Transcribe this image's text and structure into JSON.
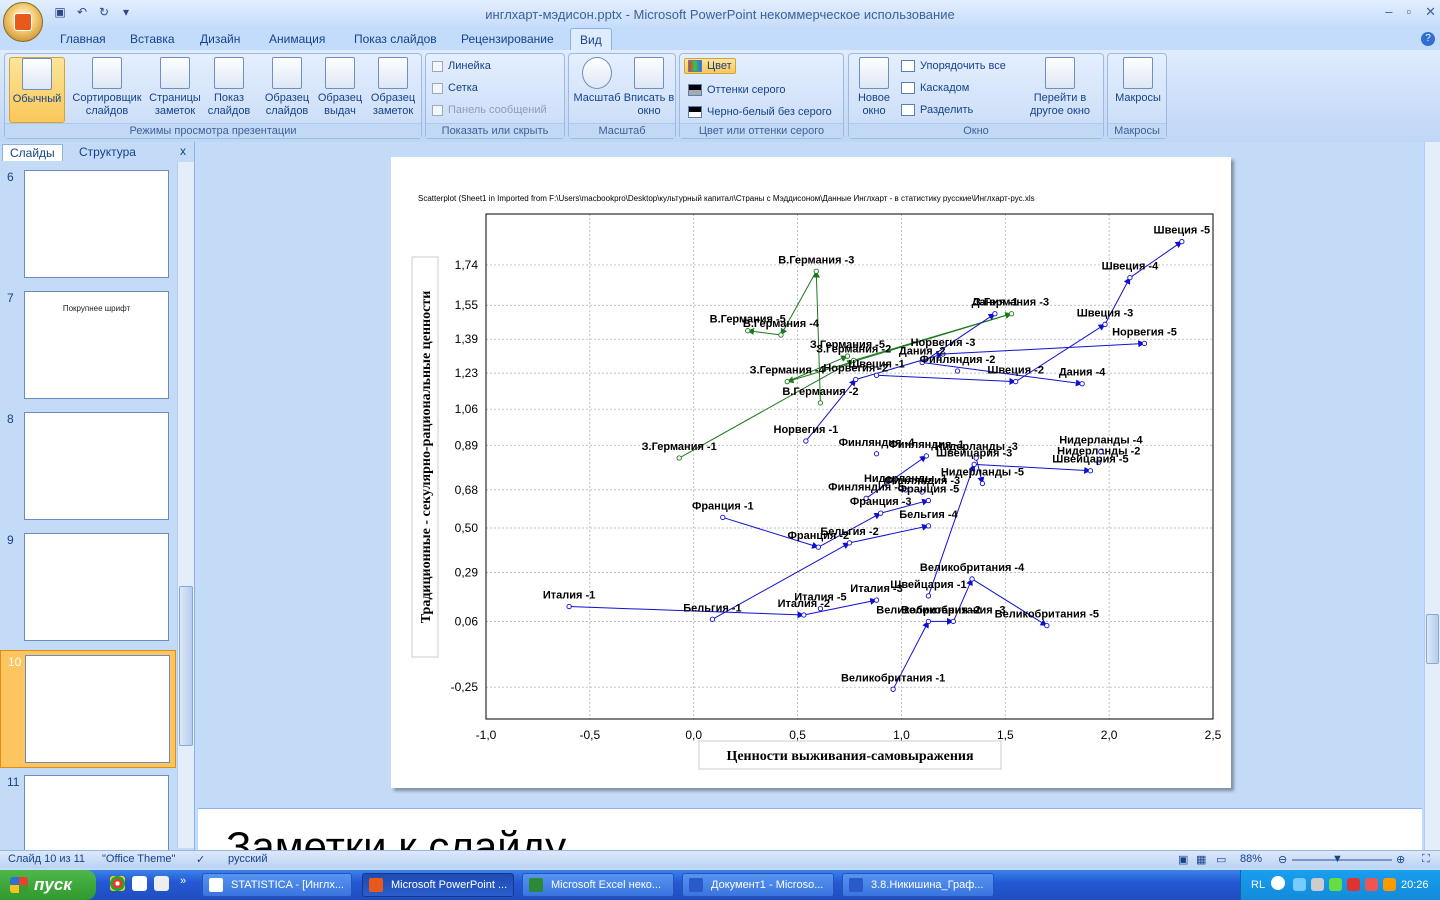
{
  "window": {
    "title": "инглхарт-мэдисон.pptx - Microsoft PowerPoint некоммерческое использование"
  },
  "ribbon": {
    "tabs": [
      "Главная",
      "Вставка",
      "Дизайн",
      "Анимация",
      "Показ слайдов",
      "Рецензирование",
      "Вид"
    ],
    "active_tab": "Вид",
    "groups": {
      "views": {
        "name": "Режимы просмотра презентации",
        "buttons": [
          "Обычный",
          "Сортировщик слайдов",
          "Страницы заметок",
          "Показ слайдов",
          "Образец слайдов",
          "Образец выдач",
          "Образец заметок"
        ]
      },
      "show": {
        "name": "Показать или скрыть",
        "items": [
          "Линейка",
          "Сетка",
          "Панель сообщений"
        ]
      },
      "zoom": {
        "name": "Масштаб",
        "buttons": [
          "Масштаб",
          "Вписать в окно"
        ]
      },
      "color": {
        "name": "Цвет или оттенки серого",
        "items": [
          "Цвет",
          "Оттенки серого",
          "Черно-белый без серого"
        ]
      },
      "window": {
        "name": "Окно",
        "new_window": "Новое окно",
        "items": [
          "Упорядочить все",
          "Каскадом",
          "Разделить"
        ],
        "switch": "Перейти в другое окно"
      },
      "macros": {
        "name": "Макросы",
        "button": "Макросы"
      }
    }
  },
  "panel": {
    "tabs": [
      "Слайды",
      "Структура"
    ],
    "close": "x"
  },
  "thumbnails": [
    {
      "num": "6",
      "caption": ""
    },
    {
      "num": "7",
      "caption": "Покрупнее шрифт"
    },
    {
      "num": "8",
      "caption": ""
    },
    {
      "num": "9",
      "caption": ""
    },
    {
      "num": "10",
      "caption": ""
    },
    {
      "num": "11",
      "caption": ""
    }
  ],
  "notes": {
    "text": "Заметки к слайду"
  },
  "status": {
    "slide": "Слайд 10 из 11",
    "theme": "\"Office Theme\"",
    "lang": "русский",
    "zoom": "88%"
  },
  "taskbar": {
    "start": "пуск",
    "items": [
      "STATISTICA - [Инглх...",
      "Microsoft PowerPoint ...",
      "Microsoft Excel неко...",
      "Документ1 - Microso...",
      "3.8.Никишина_Граф..."
    ],
    "lang": "RL",
    "time": "20:26"
  },
  "chart_data": {
    "type": "scatter",
    "title": "Scatterplot (Sheet1 in Imported from F:\\Users\\macbookpro\\Desktop\\культурный капитал\\Страны с Мэддисоном\\Данные Инглхарт - в статистику русские\\Инглхарт-рус.xls",
    "xlabel": "Ценности выживания-самовыражения",
    "ylabel": "Традиционные - секулярно-рациональные ценности",
    "xlim": [
      -1.0,
      2.5
    ],
    "ylim": [
      -0.4,
      1.98
    ],
    "xticks": [
      "-1,0",
      "-0,5",
      "0,0",
      "0,5",
      "1,0",
      "1,5",
      "2,0",
      "2,5"
    ],
    "yticks": [
      "-0,25",
      "0,06",
      "0,29",
      "0,50",
      "0,68",
      "0,89",
      "1,06",
      "1,23",
      "1,39",
      "1,55",
      "1,74"
    ],
    "xtick_values": [
      -1.0,
      -0.5,
      0.0,
      0.5,
      1.0,
      1.5,
      2.0,
      2.5
    ],
    "ytick_values": [
      -0.25,
      0.06,
      0.29,
      0.5,
      0.68,
      0.89,
      1.06,
      1.23,
      1.39,
      1.55,
      1.74
    ],
    "grid": true,
    "series": [
      {
        "name": "З.Германия",
        "color": "#1a7a1a",
        "points": [
          {
            "label": "З.Германия -1",
            "x": -0.07,
            "y": 0.83
          },
          {
            "label": "З.Германия -2",
            "x": 0.77,
            "y": 1.29
          },
          {
            "label": "З.Германия -3",
            "x": 1.53,
            "y": 1.51
          },
          {
            "label": "З.Германия -4",
            "x": 0.45,
            "y": 1.19
          },
          {
            "label": "З.Германия -5",
            "x": 0.74,
            "y": 1.31
          }
        ]
      },
      {
        "name": "В.Германия",
        "color": "#1a7a1a",
        "points": [
          {
            "label": "В.Германия -2",
            "x": 0.61,
            "y": 1.09
          },
          {
            "label": "В.Германия -3",
            "x": 0.59,
            "y": 1.71
          },
          {
            "label": "В.Германия -4",
            "x": 0.42,
            "y": 1.41
          },
          {
            "label": "В.Германия -5",
            "x": 0.26,
            "y": 1.43
          }
        ]
      },
      {
        "name": "Швеция",
        "color": "#1010d0",
        "points": [
          {
            "label": "Швеция -1",
            "x": 0.88,
            "y": 1.22
          },
          {
            "label": "Швеция -2",
            "x": 1.55,
            "y": 1.19
          },
          {
            "label": "Швеция -3",
            "x": 1.98,
            "y": 1.46
          },
          {
            "label": "Швеция -4",
            "x": 2.1,
            "y": 1.68
          },
          {
            "label": "Швеция -5",
            "x": 2.35,
            "y": 1.85
          }
        ]
      },
      {
        "name": "Норвегия",
        "color": "#1010d0",
        "points": [
          {
            "label": "Норвегия -1",
            "x": 0.54,
            "y": 0.91
          },
          {
            "label": "Норвегия -2",
            "x": 0.78,
            "y": 1.2
          },
          {
            "label": "Норвегия -3",
            "x": 1.2,
            "y": 1.32
          },
          {
            "label": "Норвегия -5",
            "x": 2.17,
            "y": 1.37
          }
        ]
      },
      {
        "name": "Дания",
        "color": "#1010d0",
        "points": [
          {
            "label": "Дания -1",
            "x": 1.45,
            "y": 1.51
          },
          {
            "label": "Дания -2",
            "x": 1.1,
            "y": 1.28
          },
          {
            "label": "Дания -4",
            "x": 1.87,
            "y": 1.18
          }
        ]
      },
      {
        "name": "Финляндия",
        "color": "#1010d0",
        "points": [
          {
            "label": "Финляндия -1",
            "x": 1.12,
            "y": 0.84
          },
          {
            "label": "Финляндия -2",
            "x": 1.27,
            "y": 1.24
          },
          {
            "label": "Финляндия -3",
            "x": 1.1,
            "y": 0.67
          },
          {
            "label": "Финляндия -4",
            "x": 0.88,
            "y": 0.85
          },
          {
            "label": "Финляндия -5",
            "x": 0.83,
            "y": 0.64
          }
        ]
      },
      {
        "name": "Нидерланды",
        "color": "#1010d0",
        "points": [
          {
            "label": "Нидерланды -1",
            "x": 1.02,
            "y": 0.68
          },
          {
            "label": "Нидерланды -2",
            "x": 1.95,
            "y": 0.81
          },
          {
            "label": "Нидерланды -3",
            "x": 1.36,
            "y": 0.83
          },
          {
            "label": "Нидерланды -4",
            "x": 1.96,
            "y": 0.86
          },
          {
            "label": "Нидерланды -5",
            "x": 1.39,
            "y": 0.71
          }
        ]
      },
      {
        "name": "Швейцария",
        "color": "#1010d0",
        "points": [
          {
            "label": "Швейцария -1",
            "x": 1.13,
            "y": 0.18
          },
          {
            "label": "Швейцария -3",
            "x": 1.35,
            "y": 0.8
          },
          {
            "label": "Швейцария -5",
            "x": 1.91,
            "y": 0.77
          }
        ]
      },
      {
        "name": "Франция",
        "color": "#1010d0",
        "points": [
          {
            "label": "Франция -1",
            "x": 0.14,
            "y": 0.55
          },
          {
            "label": "Франция -2",
            "x": 0.6,
            "y": 0.41
          },
          {
            "label": "Франция -3",
            "x": 0.9,
            "y": 0.57
          },
          {
            "label": "Франция -5",
            "x": 1.13,
            "y": 0.63
          }
        ]
      },
      {
        "name": "Бельгия",
        "color": "#1010d0",
        "points": [
          {
            "label": "Бельгия -1",
            "x": 0.09,
            "y": 0.07
          },
          {
            "label": "Бельгия -2",
            "x": 0.75,
            "y": 0.43
          },
          {
            "label": "Бельгия -4",
            "x": 1.13,
            "y": 0.51
          }
        ]
      },
      {
        "name": "Италия",
        "color": "#1010d0",
        "points": [
          {
            "label": "Италия -1",
            "x": -0.6,
            "y": 0.13
          },
          {
            "label": "Италия -2",
            "x": 0.53,
            "y": 0.09
          },
          {
            "label": "Италия -3",
            "x": 0.88,
            "y": 0.16
          },
          {
            "label": "Италия -5",
            "x": 0.61,
            "y": 0.12
          }
        ]
      },
      {
        "name": "Великобритания",
        "color": "#1010d0",
        "points": [
          {
            "label": "Великобритания -1",
            "x": 0.96,
            "y": -0.26
          },
          {
            "label": "Великобритания -2",
            "x": 1.13,
            "y": 0.06
          },
          {
            "label": "Великобритания -3",
            "x": 1.25,
            "y": 0.06
          },
          {
            "label": "Великобритания -4",
            "x": 1.34,
            "y": 0.26
          },
          {
            "label": "Великобритания -5",
            "x": 1.7,
            "y": 0.04
          }
        ]
      }
    ],
    "paths": [
      {
        "color": "#1a7a1a",
        "from": "З.Германия -1",
        "to": "З.Германия -2"
      },
      {
        "color": "#1a7a1a",
        "from": "З.Германия -2",
        "to": "З.Германия -3"
      },
      {
        "color": "#1a7a1a",
        "from": "З.Германия -3",
        "to": "З.Германия -4"
      },
      {
        "color": "#1a7a1a",
        "from": "З.Германия -4",
        "to": "З.Германия -5"
      },
      {
        "color": "#1a7a1a",
        "from": "В.Германия -2",
        "to": "В.Германия -3"
      },
      {
        "color": "#1a7a1a",
        "from": "В.Германия -3",
        "to": "В.Германия -4"
      },
      {
        "color": "#1a7a1a",
        "from": "В.Германия -4",
        "to": "В.Германия -5"
      },
      {
        "color": "#1010d0",
        "from": "Швеция -1",
        "to": "Швеция -2"
      },
      {
        "color": "#1010d0",
        "from": "Швеция -2",
        "to": "Швеция -3"
      },
      {
        "color": "#1010d0",
        "from": "Швеция -3",
        "to": "Швеция -4"
      },
      {
        "color": "#1010d0",
        "from": "Швеция -4",
        "to": "Швеция -5"
      },
      {
        "color": "#1010d0",
        "from": "Норвегия -1",
        "to": "Норвегия -2"
      },
      {
        "color": "#1010d0",
        "from": "Норвегия -2",
        "to": "Норвегия -3"
      },
      {
        "color": "#1010d0",
        "from": "Норвегия -3",
        "to": "Норвегия -5"
      },
      {
        "color": "#1010d0",
        "from": "Дания -2",
        "to": "Дания -1"
      },
      {
        "color": "#1010d0",
        "from": "Дания -2",
        "to": "Дания -4"
      },
      {
        "color": "#1010d0",
        "from": "Финляндия -5",
        "to": "Финляндия -1"
      },
      {
        "color": "#1010d0",
        "from": "Нидерланды -3",
        "to": "Нидерланды -5"
      },
      {
        "color": "#1010d0",
        "from": "Швейцария -1",
        "to": "Швейцария -3"
      },
      {
        "color": "#1010d0",
        "from": "Швейцария -3",
        "to": "Швейцария -5"
      },
      {
        "color": "#1010d0",
        "from": "Франция -1",
        "to": "Франция -2"
      },
      {
        "color": "#1010d0",
        "from": "Франция -2",
        "to": "Франция -3"
      },
      {
        "color": "#1010d0",
        "from": "Франция -3",
        "to": "Франция -5"
      },
      {
        "color": "#1010d0",
        "from": "Бельгия -1",
        "to": "Бельгия -2"
      },
      {
        "color": "#1010d0",
        "from": "Бельгия -2",
        "to": "Бельгия -4"
      },
      {
        "color": "#1010d0",
        "from": "Италия -1",
        "to": "Италия -2"
      },
      {
        "color": "#1010d0",
        "from": "Италия -2",
        "to": "Италия -3"
      },
      {
        "color": "#1010d0",
        "from": "Великобритания -1",
        "to": "Великобритания -2"
      },
      {
        "color": "#1010d0",
        "from": "Великобритания -2",
        "to": "Великобритания -3"
      },
      {
        "color": "#1010d0",
        "from": "Великобритания -3",
        "to": "Великобритания -4"
      },
      {
        "color": "#1010d0",
        "from": "Великобритания -4",
        "to": "Великобритания -5"
      }
    ]
  }
}
